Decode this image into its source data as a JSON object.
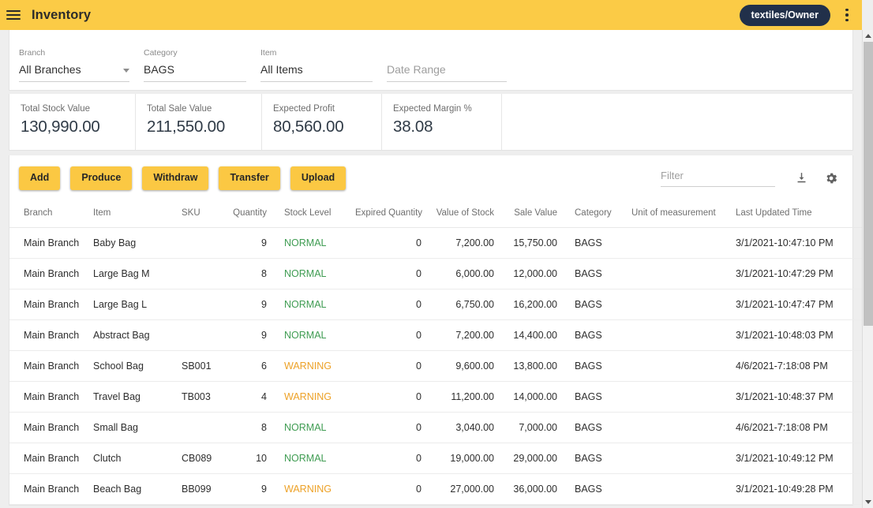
{
  "appbar": {
    "menu_icon": "hamburger-icon",
    "title": "Inventory",
    "user_badge": "textiles/Owner",
    "overflow_icon": "vertical-dots-icon"
  },
  "filters": [
    {
      "label": "Branch",
      "value": "All Branches",
      "has_caret": true,
      "is_placeholder": false
    },
    {
      "label": "Category",
      "value": "BAGS",
      "has_caret": false,
      "is_placeholder": false
    },
    {
      "label": "Item",
      "value": "All Items",
      "has_caret": false,
      "is_placeholder": false
    },
    {
      "label": "",
      "value": "Date Range",
      "has_caret": false,
      "is_placeholder": true
    }
  ],
  "kpis": [
    {
      "label": "Total Stock Value",
      "value": "130,990.00"
    },
    {
      "label": "Total Sale Value",
      "value": "211,550.00"
    },
    {
      "label": "Expected Profit",
      "value": "80,560.00"
    },
    {
      "label": "Expected Margin %",
      "value": "38.08"
    }
  ],
  "actions": {
    "buttons": [
      "Add",
      "Produce",
      "Withdraw",
      "Transfer",
      "Upload"
    ],
    "filter_placeholder": "Filter",
    "download_icon": "download-icon",
    "settings_icon": "gear-icon"
  },
  "table": {
    "columns": [
      "Branch",
      "Item",
      "SKU",
      "Quantity",
      "Stock Level",
      "Expired Quantity",
      "Value of Stock",
      "Sale Value",
      "Category",
      "Unit of measurement",
      "Last Updated Time"
    ],
    "rows": [
      {
        "branch": "Main Branch",
        "item": "Baby Bag",
        "sku": "",
        "quantity": "9",
        "stock_level": "NORMAL",
        "expired_quantity": "0",
        "value_of_stock": "7,200.00",
        "sale_value": "15,750.00",
        "category": "BAGS",
        "uom": "",
        "last_updated": "3/1/2021-10:47:10 PM"
      },
      {
        "branch": "Main Branch",
        "item": "Large Bag M",
        "sku": "",
        "quantity": "8",
        "stock_level": "NORMAL",
        "expired_quantity": "0",
        "value_of_stock": "6,000.00",
        "sale_value": "12,000.00",
        "category": "BAGS",
        "uom": "",
        "last_updated": "3/1/2021-10:47:29 PM"
      },
      {
        "branch": "Main Branch",
        "item": "Large Bag L",
        "sku": "",
        "quantity": "9",
        "stock_level": "NORMAL",
        "expired_quantity": "0",
        "value_of_stock": "6,750.00",
        "sale_value": "16,200.00",
        "category": "BAGS",
        "uom": "",
        "last_updated": "3/1/2021-10:47:47 PM"
      },
      {
        "branch": "Main Branch",
        "item": "Abstract Bag",
        "sku": "",
        "quantity": "9",
        "stock_level": "NORMAL",
        "expired_quantity": "0",
        "value_of_stock": "7,200.00",
        "sale_value": "14,400.00",
        "category": "BAGS",
        "uom": "",
        "last_updated": "3/1/2021-10:48:03 PM"
      },
      {
        "branch": "Main Branch",
        "item": "School Bag",
        "sku": "SB001",
        "quantity": "6",
        "stock_level": "WARNING",
        "expired_quantity": "0",
        "value_of_stock": "9,600.00",
        "sale_value": "13,800.00",
        "category": "BAGS",
        "uom": "",
        "last_updated": "4/6/2021-7:18:08 PM"
      },
      {
        "branch": "Main Branch",
        "item": "Travel Bag",
        "sku": "TB003",
        "quantity": "4",
        "stock_level": "WARNING",
        "expired_quantity": "0",
        "value_of_stock": "11,200.00",
        "sale_value": "14,000.00",
        "category": "BAGS",
        "uom": "",
        "last_updated": "3/1/2021-10:48:37 PM"
      },
      {
        "branch": "Main Branch",
        "item": "Small Bag",
        "sku": "",
        "quantity": "8",
        "stock_level": "NORMAL",
        "expired_quantity": "0",
        "value_of_stock": "3,040.00",
        "sale_value": "7,000.00",
        "category": "BAGS",
        "uom": "",
        "last_updated": "4/6/2021-7:18:08 PM"
      },
      {
        "branch": "Main Branch",
        "item": "Clutch",
        "sku": "CB089",
        "quantity": "10",
        "stock_level": "NORMAL",
        "expired_quantity": "0",
        "value_of_stock": "19,000.00",
        "sale_value": "29,000.00",
        "category": "BAGS",
        "uom": "",
        "last_updated": "3/1/2021-10:49:12 PM"
      },
      {
        "branch": "Main Branch",
        "item": "Beach Bag",
        "sku": "BB099",
        "quantity": "9",
        "stock_level": "WARNING",
        "expired_quantity": "0",
        "value_of_stock": "27,000.00",
        "sale_value": "36,000.00",
        "category": "BAGS",
        "uom": "",
        "last_updated": "3/1/2021-10:49:28 PM"
      }
    ]
  },
  "colors": {
    "brand_amber": "#fbcb46",
    "badge_navy": "#21304a",
    "level_normal": "#3f9c52",
    "level_warning": "#eda126"
  }
}
